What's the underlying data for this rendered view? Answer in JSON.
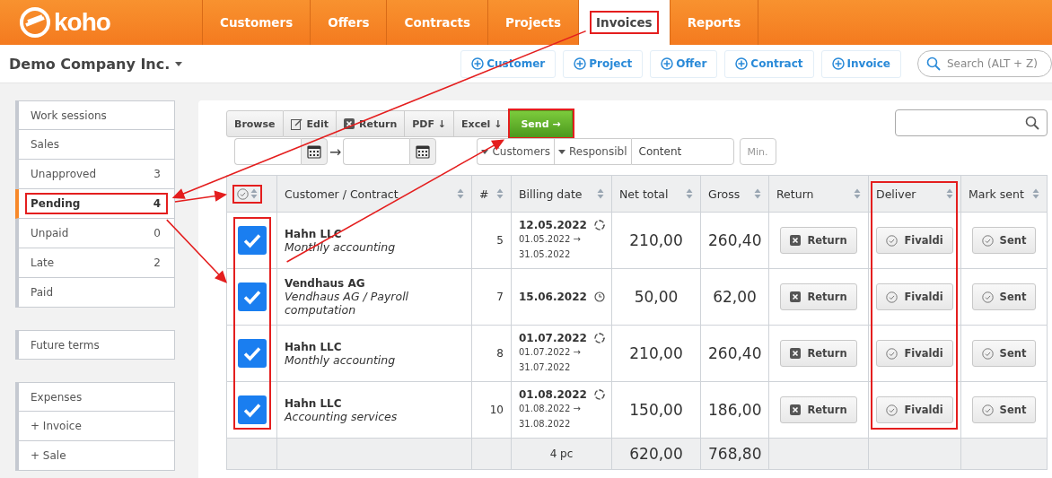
{
  "logo": {
    "text": "koho"
  },
  "nav": [
    {
      "label": "Customers",
      "selected": false,
      "highlighted": false
    },
    {
      "label": "Offers",
      "selected": false,
      "highlighted": false
    },
    {
      "label": "Contracts",
      "selected": false,
      "highlighted": false
    },
    {
      "label": "Projects",
      "selected": false,
      "highlighted": false
    },
    {
      "label": "Invoices",
      "selected": true,
      "highlighted": true
    },
    {
      "label": "Reports",
      "selected": false,
      "highlighted": false
    }
  ],
  "company": "Demo Company Inc.",
  "quick_add": [
    "Customer",
    "Project",
    "Offer",
    "Contract",
    "Invoice"
  ],
  "search": {
    "placeholder": "Search (ALT + Z)"
  },
  "sidebar": {
    "groups": [
      [
        {
          "label": "Work sessions",
          "selected": false,
          "highlighted": false
        },
        {
          "label": "Sales",
          "selected": false,
          "highlighted": false
        },
        {
          "label": "Unapproved",
          "count": "3",
          "selected": false,
          "highlighted": false
        },
        {
          "label": "Pending",
          "count": "4",
          "selected": true,
          "highlighted": true
        },
        {
          "label": "Unpaid",
          "count": "0",
          "selected": false,
          "highlighted": false
        },
        {
          "label": "Late",
          "count": "2",
          "selected": false,
          "highlighted": false
        },
        {
          "label": "Paid",
          "selected": false,
          "highlighted": false
        }
      ],
      [
        {
          "label": "Future terms",
          "selected": false,
          "highlighted": false
        }
      ],
      [
        {
          "label": "Expenses",
          "selected": false,
          "highlighted": false
        },
        {
          "label": "+ Invoice",
          "selected": false,
          "highlighted": false
        },
        {
          "label": "+ Sale",
          "selected": false,
          "highlighted": false
        }
      ]
    ]
  },
  "toolbar": [
    {
      "label": "Browse",
      "kind": "plain",
      "highlighted": false
    },
    {
      "label": "Edit",
      "kind": "edit",
      "highlighted": false
    },
    {
      "label": "Return",
      "kind": "return",
      "highlighted": false
    },
    {
      "label": "PDF ↓",
      "kind": "plain",
      "highlighted": false
    },
    {
      "label": "Excel ↓",
      "kind": "plain",
      "highlighted": false
    },
    {
      "label": "Send →",
      "kind": "send",
      "highlighted": true
    }
  ],
  "filters": {
    "arrow": "→",
    "dropdowns": [
      "Customers",
      "Responsibl"
    ],
    "content": {
      "placeholder": "Content"
    },
    "min_button": "Min."
  },
  "table": {
    "columns": [
      {
        "kind": "check",
        "highlighted": false,
        "header_highlighted": true,
        "cells_highlighted": true
      },
      {
        "kind": "text",
        "label": "Customer / Contract",
        "highlighted": false
      },
      {
        "kind": "text",
        "label": "#",
        "highlighted": false
      },
      {
        "kind": "text",
        "label": "Billing date",
        "highlighted": false
      },
      {
        "kind": "text",
        "label": "Net total",
        "highlighted": false
      },
      {
        "kind": "text",
        "label": "Gross",
        "highlighted": false
      },
      {
        "kind": "text",
        "label": "Return",
        "highlighted": false
      },
      {
        "kind": "text",
        "label": "Deliver",
        "highlighted": true
      },
      {
        "kind": "text",
        "label": "Mark sent",
        "highlighted": false
      }
    ],
    "rows": [
      {
        "checked": true,
        "customer": "Hahn LLC",
        "contract": "Monthly accounting",
        "number": "5",
        "billing_date": "12.05.2022",
        "kind": "recurring",
        "period_start": "01.05.2022 →",
        "period_end": "31.05.2022",
        "net": "210,00",
        "gross": "260,40",
        "return": "Return",
        "deliver": "Fivaldi",
        "sent": "Sent"
      },
      {
        "checked": true,
        "customer": "Vendhaus AG",
        "contract": "Vendhaus AG / Payroll computation",
        "number": "7",
        "billing_date": "15.06.2022",
        "kind": "scheduled",
        "net": "50,00",
        "gross": "62,00",
        "return": "Return",
        "deliver": "Fivaldi",
        "sent": "Sent"
      },
      {
        "checked": true,
        "customer": "Hahn LLC",
        "contract": "Monthly accounting",
        "number": "8",
        "billing_date": "01.07.2022",
        "kind": "recurring",
        "period_start": "01.07.2022 →",
        "period_end": "31.07.2022",
        "net": "210,00",
        "gross": "260,40",
        "return": "Return",
        "deliver": "Fivaldi",
        "sent": "Sent"
      },
      {
        "checked": true,
        "customer": "Hahn LLC",
        "contract": "Accounting services",
        "number": "10",
        "billing_date": "01.08.2022",
        "kind": "recurring",
        "period_start": "01.08.2022 →",
        "period_end": "31.08.2022",
        "net": "150,00",
        "gross": "186,00",
        "return": "Return",
        "deliver": "Fivaldi",
        "sent": "Sent"
      }
    ],
    "footer": {
      "count": "4 pc",
      "net": "620,00",
      "gross": "768,80"
    }
  }
}
